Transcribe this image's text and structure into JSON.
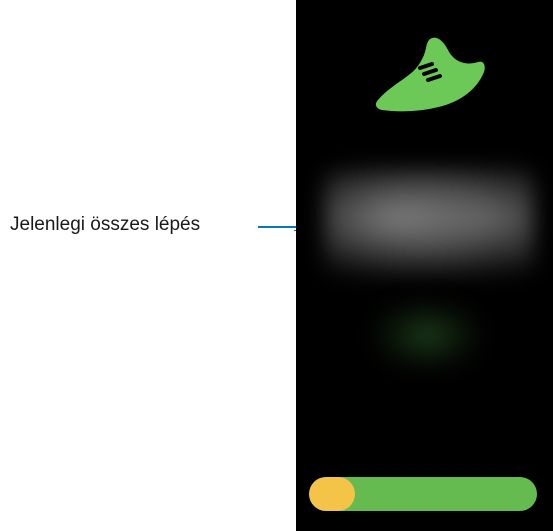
{
  "callout": {
    "label": "Jelenlegi összes lépés"
  },
  "screen": {
    "icon": "running-shoe-icon",
    "step_count": "",
    "goal": "",
    "progress": {
      "fraction": 0.2,
      "track_color": "#66bb50",
      "fill_color": "#f3c447"
    }
  },
  "colors": {
    "accent_green": "#66bb50",
    "callout_line": "#0a78b7",
    "screen_bg": "#000000"
  }
}
